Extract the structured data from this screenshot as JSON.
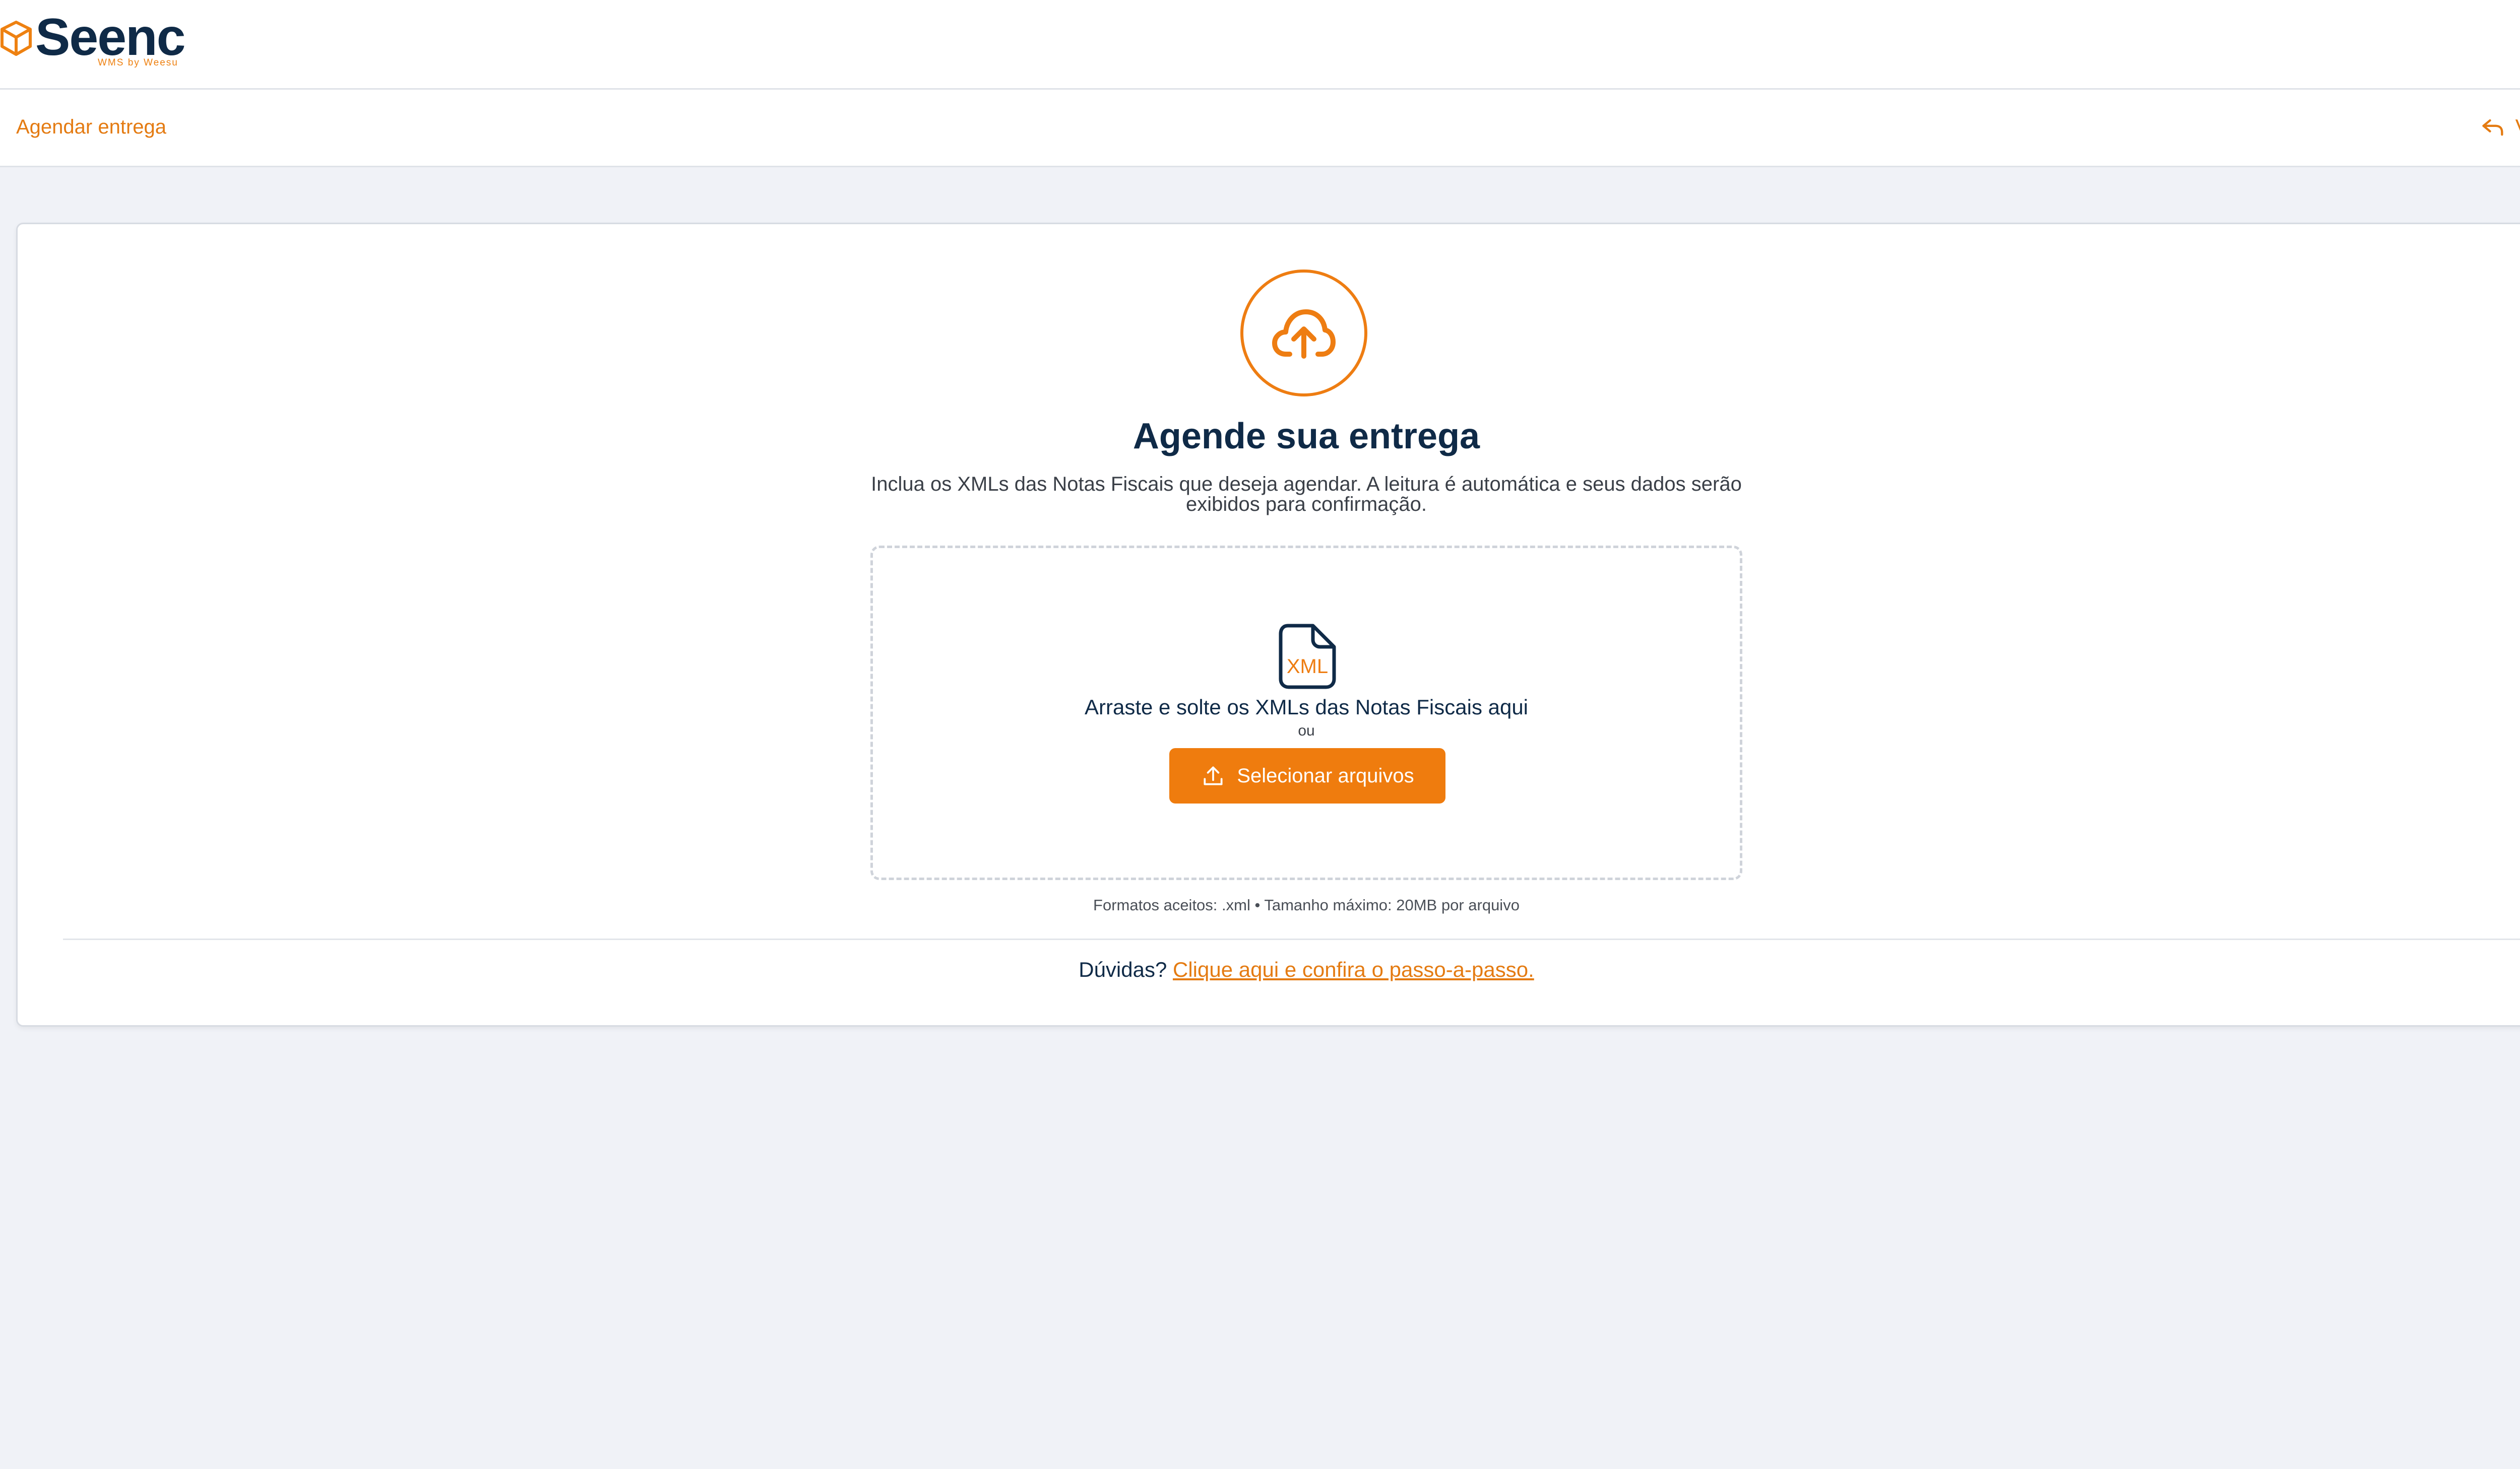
{
  "brand": {
    "name": "Seenc",
    "tagline": "WMS by Weesu",
    "accent_color": "#ee8111",
    "primary_color": "#0f2a47"
  },
  "subheader": {
    "breadcrumb": "Agendar entrega",
    "back_label": "Voltar"
  },
  "card": {
    "title": "Agende sua entrega",
    "description": "Inclua os XMLs das Notas Fiscais que deseja agendar. A leitura é automática e seus dados serão exibidos para confirmação.",
    "dropzone": {
      "file_icon_text": "XML",
      "drop_text": "Arraste e solte os XMLs das Notas Fiscais aqui",
      "or_text": "ou",
      "button_label": "Selecionar arquivos"
    },
    "formats_text": "Formatos aceitos: .xml • Tamanho máximo: 20MB por arquivo",
    "help_prefix": "Dúvidas?",
    "help_link": "Clique aqui e confira o passo-a-passo."
  },
  "icons": [
    "cube-logo-icon",
    "reply-arrow-icon",
    "cloud-upload-icon",
    "xml-file-icon",
    "upload-icon"
  ]
}
